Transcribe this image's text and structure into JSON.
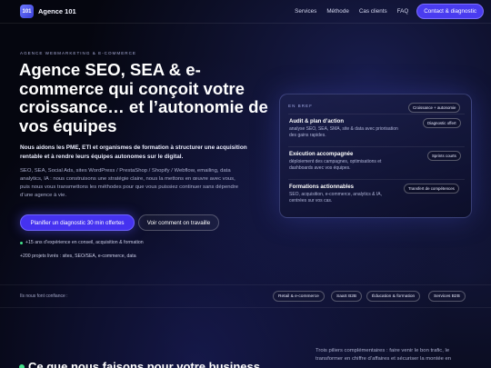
{
  "header": {
    "logo_badge": "101",
    "brand": "Agence 101",
    "nav": [
      "Services",
      "Méthode",
      "Cas clients",
      "FAQ"
    ],
    "cta": "Contact & diagnostic"
  },
  "hero": {
    "eyebrow": "AGENCE WEBMARKETING & E-COMMERCE",
    "title": "Agence SEO, SEA & e-commerce qui conçoit votre croissance… et l’autonomie de vos équipes",
    "lead": "Nous aidons les PME, ETI et organismes de formation à structurer une acquisition rentable et à rendre leurs équipes autonomes sur le digital.",
    "body": "SEO, SEA, Social Ads, sites WordPress / PrestaShop / Shopify / Webflow, emailing, data analytics, IA : nous construisons une stratégie claire, nous la mettons en œuvre avec vous, puis nous vous transmettons les méthodes pour que vous puissiez continuer sans dépendre d’une agence à vie.",
    "primary_button": "Planifier un diagnostic  30 min offertes",
    "secondary_button": "Voir comment on travaille",
    "bullets": [
      "+15 ans d’expérience en conseil, acquisition & formation",
      "+200 projets livrés : sites, SEO/SEA, e-commerce, data"
    ]
  },
  "card": {
    "kicker": "EN BREF",
    "top_pill": "Croissance + autonomie",
    "sections": [
      {
        "title": "Audit & plan d’action",
        "desc": "analyse SEO, SEA, SMA, site & data avec priorisation des gains rapides.",
        "pill": "Diagnostic offert"
      },
      {
        "title": "Exécution accompagnée",
        "desc": "déploiement des campagnes, optimisations et dashboards avec vos équipes.",
        "pill": "Sprints courts"
      },
      {
        "title": "Formations actionnables",
        "desc": "SEO, acquisition, e-commerce, analytics & IA, centrées sur vos cas.",
        "pill": "Transfert de compétences"
      }
    ]
  },
  "trust": {
    "label": "Ils nous font confiance :",
    "tags": [
      "Retail & e-commerce",
      "SaaS B2B",
      "Éducation & formation",
      "Services B2B"
    ]
  },
  "bottom": {
    "title": "Ce que nous faisons pour votre business",
    "text": "Trois piliers complémentaires : faire venir le bon trafic, le transformer en chiffre d’affaires et sécuriser la montée en"
  }
}
